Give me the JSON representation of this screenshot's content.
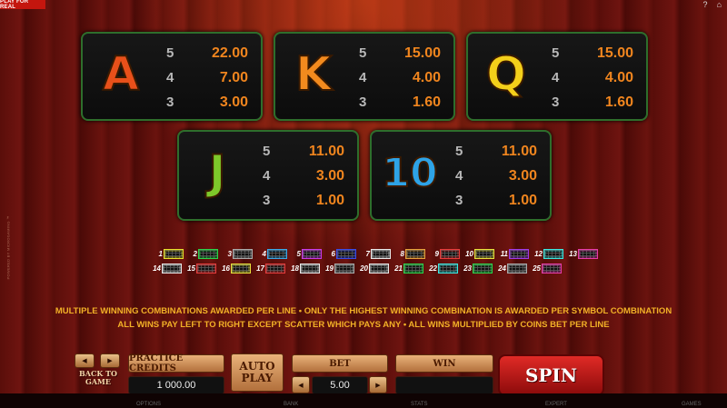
{
  "top": {
    "play_for_real": "PLAY FOR REAL"
  },
  "side_text": "POWERED BY MICROGAMING ™",
  "symbols": [
    {
      "symbol": "A",
      "color": "#e8501a",
      "pays": [
        {
          "count": "5",
          "value": "22.00"
        },
        {
          "count": "4",
          "value": "7.00"
        },
        {
          "count": "3",
          "value": "3.00"
        }
      ]
    },
    {
      "symbol": "K",
      "color": "#f28a1e",
      "pays": [
        {
          "count": "5",
          "value": "15.00"
        },
        {
          "count": "4",
          "value": "4.00"
        },
        {
          "count": "3",
          "value": "1.60"
        }
      ]
    },
    {
      "symbol": "Q",
      "color": "#f4cf1a",
      "pays": [
        {
          "count": "5",
          "value": "15.00"
        },
        {
          "count": "4",
          "value": "4.00"
        },
        {
          "count": "3",
          "value": "1.60"
        }
      ]
    },
    {
      "symbol": "J",
      "color": "#7ec82a",
      "pays": [
        {
          "count": "5",
          "value": "11.00"
        },
        {
          "count": "4",
          "value": "3.00"
        },
        {
          "count": "3",
          "value": "1.00"
        }
      ]
    },
    {
      "symbol": "10",
      "color": "#2ea3e6",
      "pays": [
        {
          "count": "5",
          "value": "11.00"
        },
        {
          "count": "4",
          "value": "3.00"
        },
        {
          "count": "3",
          "value": "1.00"
        }
      ]
    }
  ],
  "paylines": {
    "row1": [
      "1",
      "2",
      "3",
      "4",
      "5",
      "6",
      "7",
      "8",
      "9",
      "10",
      "11",
      "12",
      "13"
    ],
    "row2": [
      "14",
      "15",
      "16",
      "17",
      "18",
      "19",
      "20",
      "21",
      "22",
      "23",
      "24",
      "25"
    ],
    "row1_colors": [
      "#e8e02a",
      "#2ad44a",
      "#aaaaaa",
      "#3aa8e8",
      "#c83ae8",
      "#3a4ae8",
      "#e8e8e8",
      "#e8a03a",
      "#e83a3a",
      "#e8e03a",
      "#a03ae8",
      "#3ae8e0",
      "#e83aa8"
    ],
    "row2_colors": [
      "#e8e8e8",
      "#e83a3a",
      "#e8e03a",
      "#e83a3a",
      "#e8e8e8",
      "#aaaaaa",
      "#e8e8e8",
      "#2ad44a",
      "#3ae8e0",
      "#2ad44a",
      "#aaaaaa",
      "#e83aa8"
    ]
  },
  "rules": {
    "line1": "MULTIPLE WINNING COMBINATIONS AWARDED PER LINE  •  ONLY THE HIGHEST WINNING COMBINATION IS AWARDED PER SYMBOL COMBINATION",
    "line2": "ALL WINS PAY LEFT TO RIGHT EXCEPT SCATTER WHICH PAYS ANY  •  ALL WINS MULTIPLIED BY COINS BET PER LINE"
  },
  "controls": {
    "back_to_game": "BACK TO GAME",
    "practice_credits_label": "PRACTICE CREDITS",
    "practice_credits_value": "1 000.00",
    "auto_play": "AUTO PLAY",
    "bet_label": "BET",
    "bet_value": "5.00",
    "win_label": "WIN",
    "win_value": "",
    "spin": "SPIN"
  },
  "bottom_bar": {
    "options": "OPTIONS",
    "bank": "BANK",
    "stats": "STATS",
    "expert": "EXPERT",
    "games": "GAMES"
  }
}
